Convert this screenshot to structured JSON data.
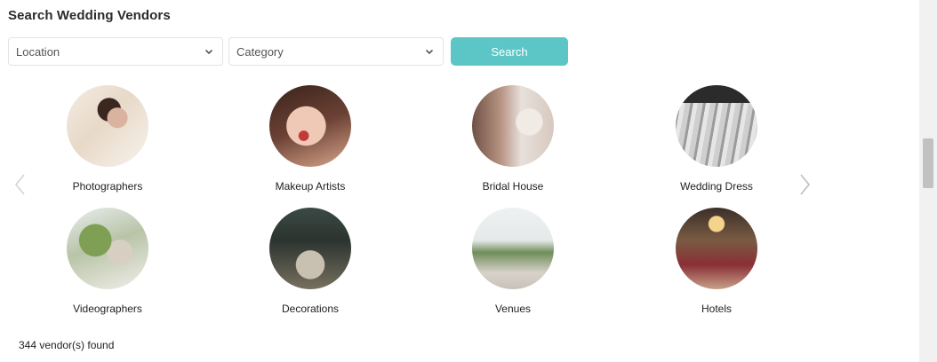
{
  "title": "Search Wedding Vendors",
  "filters": {
    "location": {
      "value": "Location",
      "icon": "chevron-down-icon"
    },
    "category": {
      "value": "Category",
      "icon": "chevron-down-icon"
    },
    "search_label": "Search",
    "search_color": "#5cc6c6"
  },
  "carousel": {
    "prev_icon": "chevron-left-icon",
    "next_icon": "chevron-right-icon",
    "categories": [
      {
        "label": "Photographers"
      },
      {
        "label": "Makeup Artists"
      },
      {
        "label": "Bridal House"
      },
      {
        "label": "Wedding Dress"
      },
      {
        "label": "Videographers"
      },
      {
        "label": "Decorations"
      },
      {
        "label": "Venues"
      },
      {
        "label": "Hotels"
      }
    ]
  },
  "results": {
    "count_text": "344 vendor(s) found"
  }
}
